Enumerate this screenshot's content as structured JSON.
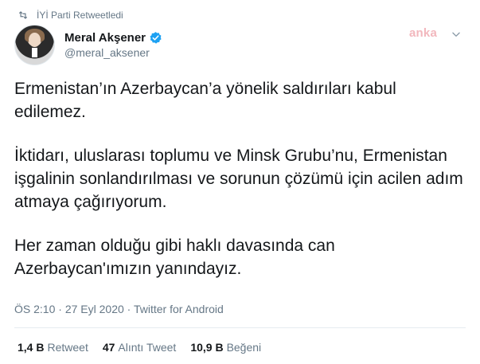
{
  "retweet_notice": "İYİ Parti Retweetledi",
  "author": {
    "name": "Meral Akşener",
    "handle": "@meral_aksener",
    "verified": true
  },
  "watermark": "anka",
  "tweet": {
    "paragraphs": [
      "Ermenistan’ın Azerbaycan’a yönelik saldırıları kabul edilemez.",
      "İktidarı, uluslarası toplumu ve Minsk Grubu’nu, Ermenistan işgalinin sonlandırılması ve sorunun çözümü için acilen adım atmaya çağırıyorum.",
      "Her zaman olduğu gibi haklı davasında can Azerbaycan'ımızın yanındayız."
    ]
  },
  "meta": {
    "time": "ÖS 2:10",
    "date": "27 Eyl 2020",
    "source": "Twitter for Android",
    "separator": "·"
  },
  "stats": {
    "retweets_count": "1,4 B",
    "retweets_label": "Retweet",
    "quotes_count": "47",
    "quotes_label": "Alıntı Tweet",
    "likes_count": "10,9 B",
    "likes_label": "Beğeni"
  },
  "colors": {
    "text": "#14171a",
    "secondary": "#657786",
    "verified": "#1da1f2",
    "watermark": "#f2b7bd"
  },
  "icons": {
    "retweet": "retweet-icon",
    "verified": "verified-badge-icon",
    "menu": "chevron-down-icon"
  }
}
